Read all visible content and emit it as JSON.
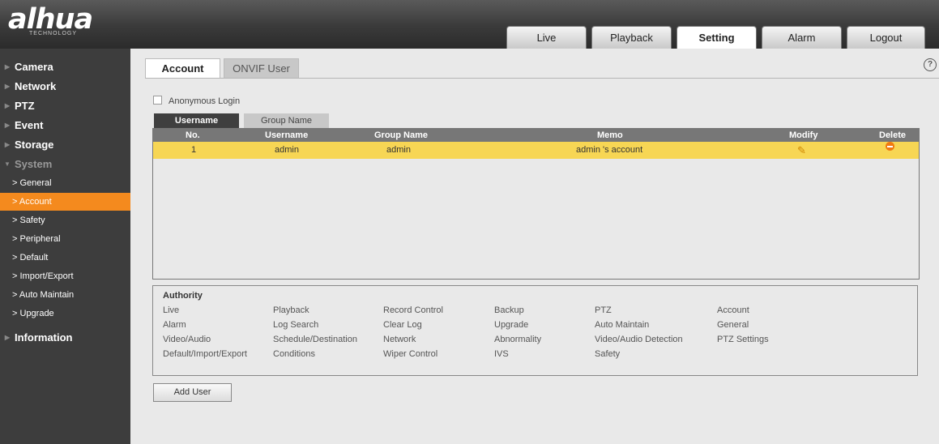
{
  "logo": {
    "main": "alhua",
    "sub": "TECHNOLOGY"
  },
  "topnav": [
    "Live",
    "Playback",
    "Setting",
    "Alarm",
    "Logout"
  ],
  "topnav_active": "Setting",
  "sidebar": {
    "camera": "Camera",
    "network": "Network",
    "ptz": "PTZ",
    "event": "Event",
    "storage": "Storage",
    "system": "System",
    "subs": [
      "> General",
      "> Account",
      "> Safety",
      "> Peripheral",
      "> Default",
      "> Import/Export",
      "> Auto Maintain",
      "> Upgrade"
    ],
    "information": "Information",
    "active_sub": "> Account",
    "accent_color": "#f48a1e"
  },
  "tabs": {
    "account": "Account",
    "onvif": "ONVIF User"
  },
  "help_icon": "?",
  "anonymous_login": "Anonymous Login",
  "subtabs": {
    "username": "Username",
    "group": "Group Name"
  },
  "table": {
    "headers": {
      "no": "No.",
      "username": "Username",
      "group": "Group Name",
      "memo": "Memo",
      "modify": "Modify",
      "delete": "Delete"
    },
    "rows": [
      {
        "no": "1",
        "username": "admin",
        "group": "admin",
        "memo": "admin 's account"
      }
    ]
  },
  "authority": {
    "title": "Authority",
    "items": [
      [
        "Live",
        "Playback",
        "Record Control",
        "Backup",
        "PTZ",
        "Account"
      ],
      [
        "Alarm",
        "Log Search",
        "Clear Log",
        "Upgrade",
        "Auto Maintain",
        "General"
      ],
      [
        "Video/Audio",
        "Schedule/Destination",
        "Network",
        "Abnormality",
        "Video/Audio Detection",
        "PTZ Settings"
      ],
      [
        "Default/Import/Export",
        "Conditions",
        "Wiper Control",
        "IVS",
        "Safety",
        ""
      ]
    ]
  },
  "add_user": "Add User"
}
